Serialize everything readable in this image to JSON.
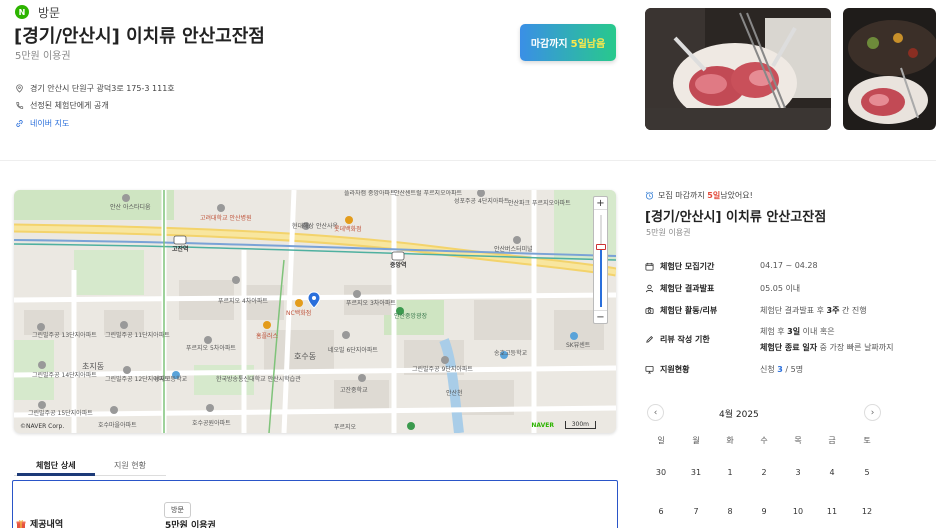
{
  "header": {
    "badge": "N",
    "visit_type": "방문",
    "title": "[경기/안산시] 이치류 안산고잔점",
    "subtitle": "5만원 이용권",
    "deadline_prefix": "마감까지",
    "deadline_value": "5일남음",
    "address": "경기 안산시 단원구 광덕3로 175-3 111호",
    "visibility": "선정된 체험단에게 공개",
    "map_link": "네이버 지도"
  },
  "map": {
    "labels": [
      "안산 아스타디움",
      "고려대학교 안산병원",
      "현대해상 안산사옥",
      "롯데백화점",
      "플라자캠 중앙아파트",
      "안산센트럴 푸르지오아파트",
      "성포주공 4단지아파트",
      "안산파크 푸르지오아파트",
      "고잔역",
      "중앙역",
      "안산버스터미널",
      "푸르지오 4차아파트",
      "NC백화점",
      "푸르지오 3차아파트",
      "안산중앙광장",
      "그린빌주공 13단지아파트",
      "그린빌주공 11단지아파트",
      "푸르지오 5차아파트",
      "홈플러스",
      "호수동",
      "네오빌 6단지아파트",
      "그린빌주공 9단지아파트",
      "송호고등학교",
      "SK뷰센트",
      "초지동",
      "그린빌주공 14단지아파트",
      "그린빌주공 12단지아파트",
      "성지고등학교",
      "한국방송통신대학교 안산시학습관",
      "고잔중학교",
      "안산천",
      "그린빌주공 15단지아파트",
      "호수마을아파트",
      "호수공원아파트",
      "푸르지오"
    ],
    "copyright": "©NAVER Corp.",
    "naver_logo": "NAVER",
    "scale": "300m",
    "zoom_in": "+",
    "zoom_out": "−",
    "zoom_level_fraction": 0.35
  },
  "tabs": [
    "체험단 상세",
    "지원 현황"
  ],
  "detail": {
    "tag": "방문",
    "provide_label": "제공내역",
    "provide_value": "5만원 이용권"
  },
  "side": {
    "notice_prefix": "모집 마감까지",
    "notice_value": "5일",
    "notice_suffix": "남았어요!",
    "title": "[경기/안산시] 이치류 안산고잔점",
    "subtitle": "5만원 이용권",
    "rows": {
      "recruit_label": "체험단 모집기간",
      "recruit_value": "04.17 ~ 04.28",
      "announce_label": "체험단 결과발표",
      "announce_value": "05.05 이내",
      "activity_label": "체험단 활동/리뷰",
      "activity_pre": "체험단 결과발표 후",
      "activity_bold": "3주",
      "activity_post": "간 진행",
      "review_label": "리뷰 작성 기한",
      "review_l1_pre": "체험 후",
      "review_l1_bold": "3일",
      "review_l1_post": "이내 혹은",
      "review_l2_bold": "체험단 종료 일자",
      "review_l2_post": "중 가장 빠른 날짜까지",
      "apply_label": "지원현황",
      "apply_pre": "신청",
      "apply_count": "3",
      "apply_post": "/ 5명"
    }
  },
  "calendar": {
    "month": "4월 2025",
    "prev": "‹",
    "next": "›",
    "dow": [
      "일",
      "월",
      "화",
      "수",
      "목",
      "금",
      "토"
    ],
    "week1": [
      "30",
      "31",
      "1",
      "2",
      "3",
      "4",
      "5"
    ],
    "week2": [
      "6",
      "7",
      "8",
      "9",
      "10",
      "11",
      "12"
    ]
  }
}
